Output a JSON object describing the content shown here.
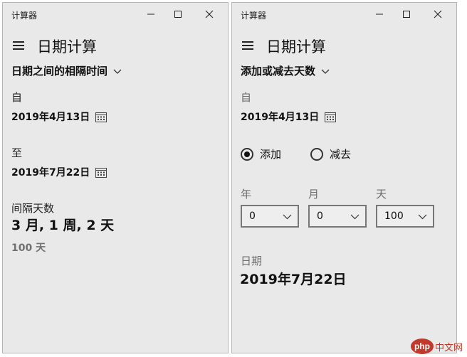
{
  "app_title": "计算器",
  "page_title": "日期计算",
  "left": {
    "mode_label": "日期之间的相隔时间",
    "from_label": "自",
    "from_date": "2019年4月13日",
    "to_label": "至",
    "to_date": "2019年7月22日",
    "diff_label": "间隔天数",
    "diff_value": "3 月, 1 周, 2 天",
    "diff_days": "100 天"
  },
  "right": {
    "mode_label": "添加或减去天数",
    "from_label": "自",
    "from_date": "2019年4月13日",
    "radio_add": "添加",
    "radio_subtract": "减去",
    "selected_operation": "添加",
    "year_label": "年",
    "month_label": "月",
    "day_label": "天",
    "year_value": "0",
    "month_value": "0",
    "day_value": "100",
    "result_label": "日期",
    "result_value": "2019年7月22日"
  },
  "icons": {
    "menu": "hamburger-icon",
    "calendar": "calendar-icon",
    "dropdown": "chevron-down-icon",
    "minimize": "minimize-icon",
    "maximize": "maximize-icon",
    "close": "close-icon"
  },
  "watermark": {
    "badge": "php",
    "text": "中文网"
  }
}
